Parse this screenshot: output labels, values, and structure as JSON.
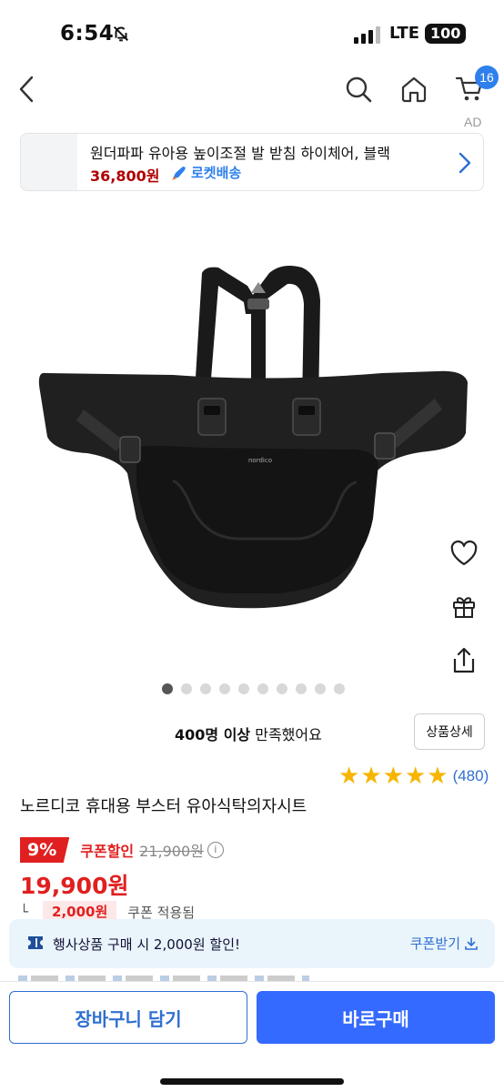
{
  "status_bar": {
    "time": "6:54",
    "network": "LTE",
    "battery": "100"
  },
  "header": {
    "icons": {
      "back": "chevron-left-icon",
      "search": "search-icon",
      "home": "home-icon",
      "cart": "cart-icon"
    },
    "cart_count": "16",
    "ad_label": "AD"
  },
  "ad_banner": {
    "title": "원더파파 유아용 높이조절 발 받침 하이체어, 블랙",
    "price": "36,800원",
    "delivery": "로켓배송"
  },
  "carousel": {
    "total": 10,
    "active": 1
  },
  "side_actions": {
    "icons": [
      "heart-icon",
      "gift-icon",
      "share-icon"
    ]
  },
  "satisfaction": {
    "emphasis": "400명 이상",
    "rest": " 만족했어요"
  },
  "detail_button": "상품상세",
  "rating": {
    "stars": 5,
    "max": 5,
    "review_count": "(480)"
  },
  "product": {
    "title": "노르디코 휴대용 부스터 유아식탁의자시트",
    "discount_rate": "9%",
    "coupon_discount_label": "쿠폰할인",
    "original_price": "21,900원",
    "sale_price": "19,900원",
    "coupon_amount": "2,000원",
    "coupon_applied": "쿠폰 적용됨"
  },
  "coupon_banner": {
    "text": "행사상품 구매 시 2,000원 할인!",
    "action": "쿠폰받기"
  },
  "bottom_bar": {
    "add_to_cart": "장바구니 담기",
    "buy_now": "바로구매"
  },
  "colors": {
    "accent": "#346aff",
    "link": "#2f6fd1",
    "sale": "#e02020",
    "star": "#f7b500"
  }
}
